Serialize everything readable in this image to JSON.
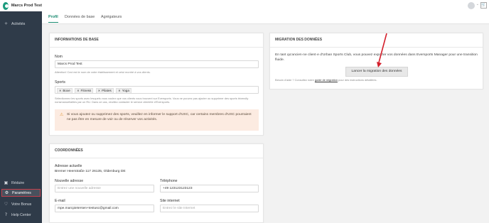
{
  "app": {
    "title": "Marcs Prod Test"
  },
  "sidebar": {
    "top": [
      {
        "label": "Activités",
        "icon": "activities-icon",
        "glyph": "✧"
      }
    ],
    "bottom": [
      {
        "label": "Réduire",
        "icon": "collapse-icon",
        "glyph": "▣"
      },
      {
        "label": "Paramètres",
        "icon": "gear-icon",
        "glyph": "⚙"
      },
      {
        "label": "Votre Bonus",
        "icon": "heart-icon",
        "glyph": "♡"
      },
      {
        "label": "Help Center",
        "icon": "help-icon",
        "glyph": "?"
      }
    ]
  },
  "topbar": {
    "avatar_initials": "",
    "caret": "⌄",
    "cart": "🛒"
  },
  "tabs": [
    "Profil",
    "Données de base",
    "Agrégateurs"
  ],
  "basic_info": {
    "title": "INFORMATIONS DE BASE",
    "name_label": "Nom",
    "name_value": "Marcs Prod Test",
    "name_help": "Attention! Ceci est le nom de votre établissement et celui montré à vos clients.",
    "sports_label": "Sports",
    "sports": [
      "Boxe",
      "Fitness",
      "Pilates",
      "Yoga"
    ],
    "sports_help": "Sélectionnez les sports avec lesquels vous voulez que vos clients vous trouvent sur Eversports. Vous ne pouvez pas ajouter ou supprimer des sports trivendly nonsmanuellaities par un RU. Dans ce cas, veuillez contacter le service clientèle d'Eversports.",
    "warning": "Si vous ajoutez ou supprimez des sports, veuillez en informer le support d'USC, car certains membres d'USC pourraient ne pas être en mesure de voir ou de réserver vos activités."
  },
  "coordinates": {
    "title": "COORDONNÉES",
    "current_address_label": "Adresse actuelle",
    "current_address": "Bremer Heerstraße 117 26135, Oldenburg DE",
    "new_address_label": "Nouvelle adresse",
    "new_address_placeholder": "Entrez une nouvelle adresse",
    "phone_label": "Téléphone",
    "phone_value": "+49 123123123123",
    "email_label": "E-mail",
    "email_value": "mpe.marcpietersen+testusc@gmail.com",
    "website_label": "Site internet",
    "website_placeholder": "Entrez le site Internet"
  },
  "migration": {
    "title": "MIGRATION DES DONNÉES",
    "text": "En tant qu'ancien·ne client·e d'Urban Sports Club, vous pouvez exporter vos données dans Eversports Manager pour une transition fluide.",
    "button": "Lancer la migration des données",
    "help_prefix": "Besoin d'aide ? Consultez notre",
    "help_link": "guide de migration",
    "help_suffix": "pour des instructions détaillées."
  }
}
